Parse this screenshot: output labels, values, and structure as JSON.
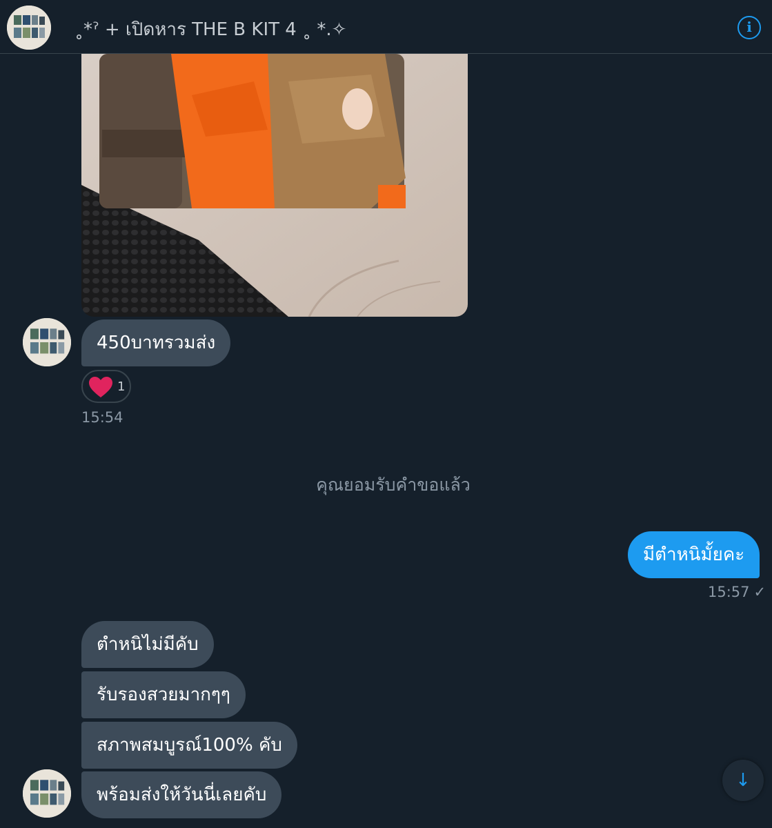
{
  "header": {
    "title": "˳*ˀ + เปิดหาร THE B KIT 4 ˳ *.✧",
    "info_icon": "info-circle-icon"
  },
  "messages": {
    "price_text": "450บาทรวมส่ง",
    "reaction_emoji": "heart-icon",
    "reaction_count": "1",
    "time_1": "15:54",
    "system_note": "คุณยอมรับคำขอแล้ว",
    "outgoing_text": "มีตำหนิมั้ยคะ",
    "time_2": "15:57",
    "read_mark": "✓",
    "reply_1": "ตำหนิไม่มีคับ",
    "reply_2": "รับรองสวยมากๆๆ",
    "reply_3": "สภาพสมบูรณ์100% คับ",
    "reply_4": "พร้อมส่งให้วันนี่เลยคับ"
  },
  "scroll_button": {
    "icon": "arrow-down-icon",
    "glyph": "↓"
  },
  "colors": {
    "background": "#15202b",
    "incoming_bubble": "#3d4b59",
    "outgoing_bubble": "#1d9bf0",
    "accent": "#1d9bf0",
    "muted_text": "#8b98a5",
    "heart": "#f91880"
  }
}
